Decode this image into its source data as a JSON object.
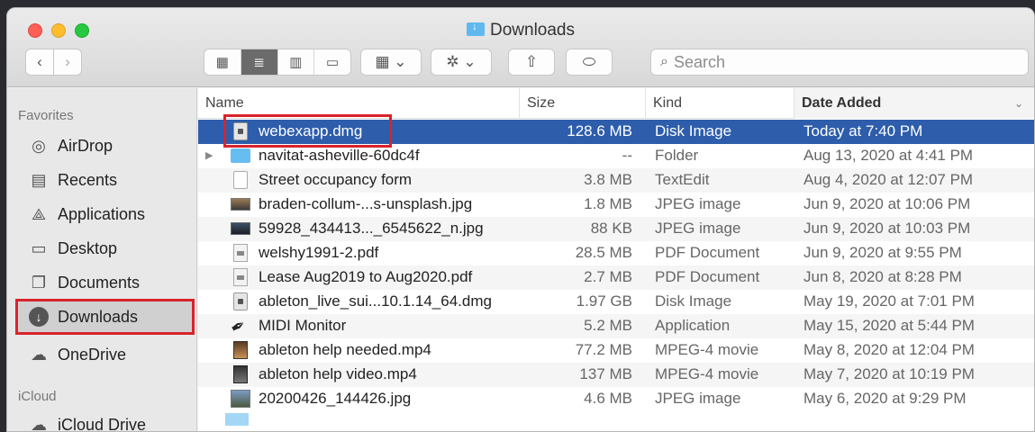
{
  "window": {
    "title": "Downloads"
  },
  "toolbar": {
    "back_icon": "chevron-left-icon",
    "forward_icon": "chevron-right-icon",
    "back_glyph": "‹",
    "forward_glyph": "›",
    "view_icons": [
      "icon-view-icon",
      "list-view-icon",
      "column-view-icon",
      "gallery-view-icon"
    ],
    "view_glyphs": [
      "▦",
      "≣",
      "▥",
      "▭"
    ],
    "group_glyph": "▦ ⌄",
    "action_glyph": "✲ ⌄",
    "share_glyph": "⇧",
    "tag_glyph": "⬭",
    "search_placeholder": "Search",
    "search_value": ""
  },
  "sidebar": {
    "favorites_header": "Favorites",
    "icloud_header": "iCloud",
    "items": [
      {
        "label": "AirDrop",
        "icon": "airdrop-icon",
        "glyph": "◎"
      },
      {
        "label": "Recents",
        "icon": "recents-icon",
        "glyph": "▤"
      },
      {
        "label": "Applications",
        "icon": "applications-icon",
        "glyph": "⟁"
      },
      {
        "label": "Desktop",
        "icon": "desktop-icon",
        "glyph": "▭"
      },
      {
        "label": "Documents",
        "icon": "documents-icon",
        "glyph": "❐"
      },
      {
        "label": "Downloads",
        "icon": "downloads-icon",
        "glyph": "↓"
      },
      {
        "label": "OneDrive",
        "icon": "cloud-icon",
        "glyph": "☁"
      }
    ],
    "icloud_items": [
      {
        "label": "iCloud Drive",
        "icon": "icloud-icon",
        "glyph": "☁"
      }
    ]
  },
  "columns": {
    "name": "Name",
    "size": "Size",
    "kind": "Kind",
    "date": "Date Added",
    "sort_glyph": "⌄"
  },
  "files": [
    {
      "name": "webexapp.dmg",
      "size": "128.6 MB",
      "kind": "Disk Image",
      "date": "Today at 7:40 PM",
      "icon": "disk-image-icon"
    },
    {
      "name": "navitat-asheville-60dc4f",
      "size": "--",
      "kind": "Folder",
      "date": "Aug 13, 2020 at 4:41 PM",
      "icon": "folder-icon",
      "disclosure": "▶"
    },
    {
      "name": "Street occupancy form",
      "size": "3.8 MB",
      "kind": "TextEdit",
      "date": "Aug 4, 2020 at 12:07 PM",
      "icon": "document-icon"
    },
    {
      "name": "braden-collum-...s-unsplash.jpg",
      "size": "1.8 MB",
      "kind": "JPEG image",
      "date": "Jun 9, 2020 at 10:06 PM",
      "icon": "image-icon"
    },
    {
      "name": "59928_434413..._6545622_n.jpg",
      "size": "88 KB",
      "kind": "JPEG image",
      "date": "Jun 9, 2020 at 10:03 PM",
      "icon": "image-icon"
    },
    {
      "name": "welshy1991-2.pdf",
      "size": "28.5 MB",
      "kind": "PDF Document",
      "date": "Jun 9, 2020 at 9:55 PM",
      "icon": "pdf-icon"
    },
    {
      "name": "Lease Aug2019 to Aug2020.pdf",
      "size": "2.7 MB",
      "kind": "PDF Document",
      "date": "Jun 8, 2020 at 8:28 PM",
      "icon": "pdf-icon"
    },
    {
      "name": "ableton_live_sui...10.1.14_64.dmg",
      "size": "1.97 GB",
      "kind": "Disk Image",
      "date": "May 19, 2020 at 7:01 PM",
      "icon": "disk-image-icon"
    },
    {
      "name": "MIDI Monitor",
      "size": "5.2 MB",
      "kind": "Application",
      "date": "May 15, 2020 at 5:44 PM",
      "icon": "app-icon"
    },
    {
      "name": "ableton help needed.mp4",
      "size": "77.2 MB",
      "kind": "MPEG-4 movie",
      "date": "May 8, 2020 at 12:04 PM",
      "icon": "video-icon"
    },
    {
      "name": "ableton help video.mp4",
      "size": "137 MB",
      "kind": "MPEG-4 movie",
      "date": "May 7, 2020 at 10:19 PM",
      "icon": "video-icon"
    },
    {
      "name": "20200426_144426.jpg",
      "size": "4.6 MB",
      "kind": "JPEG image",
      "date": "May 6, 2020 at 9:29 PM",
      "icon": "image-icon"
    }
  ],
  "colors": {
    "selection": "#2d5dab",
    "highlight_box": "#d9232b"
  }
}
